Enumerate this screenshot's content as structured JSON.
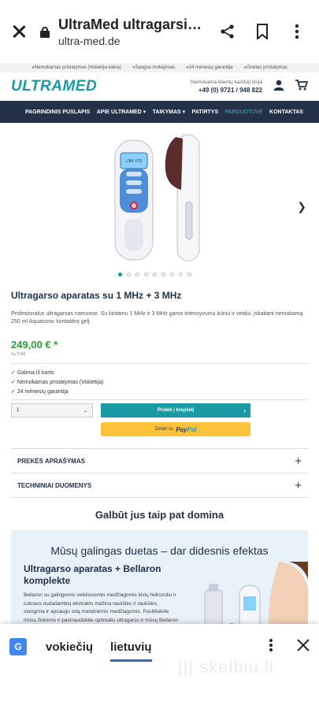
{
  "browser": {
    "title": "UltraMed ultragarsinis ...",
    "url": "ultra-med.de"
  },
  "infostrip": [
    "Nemokamas pristatymas (Vokietija kaina)",
    "Saugus mokėjimas",
    "24 mėnesių garantija",
    "Greitas pristatymas"
  ],
  "header": {
    "logo": "ULTRAMED",
    "contact_label": "Nemokama klientų karštoji linija",
    "phone": "+49 (0) 9721 / 948 822"
  },
  "nav": [
    "PAGRINDINIS PUSLAPIS",
    "APIE ULTRAMED ▾",
    "TAIKYMAS ▾",
    "PATIRTYS",
    "PARDUOTUVĖ",
    "KONTAKTAS"
  ],
  "nav_active_index": 4,
  "gallery": {
    "device_screen": "L3M-Y2S",
    "dots": 9,
    "active_dot": 0
  },
  "product": {
    "title": "Ultragarso aparatas su 1 MHz + 3 MHz",
    "description": "Profesionalus ultragarsas namuose. Su kintamu 1 MHz ir 3 MHz garso intensyvumu kūnui ir veidui, įskaitant nemokamą 250 ml Aquasonic kontaktinį gelį",
    "price": "249,00 € *",
    "vat": "Su PVM",
    "features": [
      "Galima iš karto",
      "Nemokamas pristatymas (Vokietija)",
      "24 mėnesių garantija"
    ],
    "qty": "1",
    "add_to_cart": "Pridėti į krepšelį",
    "paypal_prefix": "Direkt zu",
    "paypal_brand_a": "Pay",
    "paypal_brand_b": "Pal"
  },
  "accordion": [
    "PREKĖS APRAŠYMAS",
    "TECHNINIAI DUOMENYS"
  ],
  "related_heading": "Galbūt jus taip pat domina",
  "promo": {
    "headline": "Mūsų galingas duetas – dar didesnis efektas",
    "title": "Ultragarso aparatas + Bellaron komplekte",
    "body": "Bellaron su galingomis veikliosiomis medžiagomis kivių hidrozoliu ir cukraus nudadambių ekstraktu mažina raukšles ir raukšles, stangrina ir apsaugo odą maistinėmis medžiagomis. Pasitikėkite mūsų žiniomis ir pasinaudokite optimaliu ultragarso ir mūsų Bellaron trigubo hialurono serumo deriniu. Bellaron"
  },
  "translate": {
    "source": "vokiečių",
    "target": "lietuvių"
  },
  "watermark": "||| skelbiu.lt"
}
